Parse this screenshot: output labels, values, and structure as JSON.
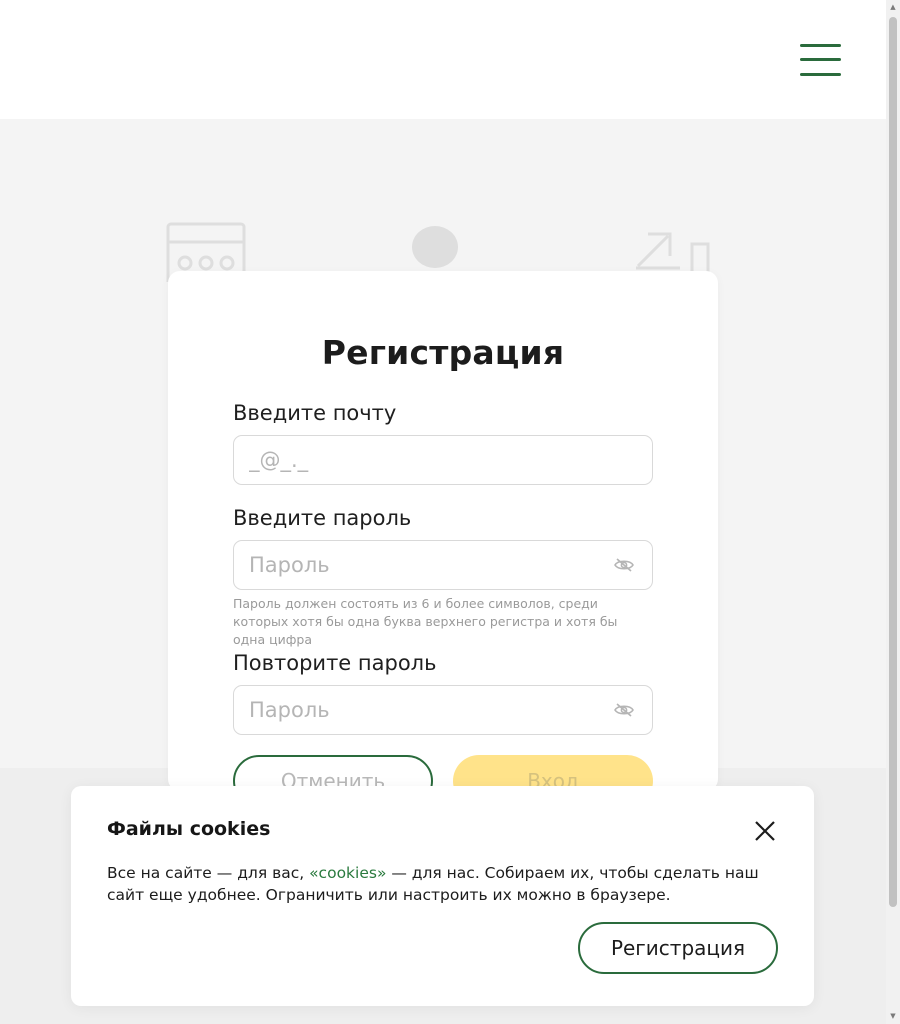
{
  "header": {
    "menu_icon": "hamburger-menu-icon"
  },
  "registration": {
    "title": "Регистрация",
    "email_label": "Введите почту",
    "email_placeholder": "_@_._",
    "password_label": "Введите пароль",
    "password_placeholder": "Пароль",
    "password_hint": "Пароль должен состоять из 6 и более символов, среди которых хотя бы одна буква верхнего регистра и хотя бы одна цифра",
    "repeat_label": "Повторите пароль",
    "repeat_placeholder": "Пароль",
    "cancel_label": "Отменить",
    "login_label": "Вход"
  },
  "cookie_banner": {
    "title": "Файлы cookies",
    "text_before": "Все на сайте — для вас, ",
    "link_text": "«cookies»",
    "text_after": " — для нас. Собираем их, чтобы сделать наш сайт еще удобнее. Ограничить или настроить их можно в браузере.",
    "button_label": "Регистрация"
  },
  "colors": {
    "accent_green": "#2a6b3c",
    "link_green": "#2a7a3e",
    "login_yellow": "#ffe38a",
    "page_bg": "#f4f4f4"
  }
}
